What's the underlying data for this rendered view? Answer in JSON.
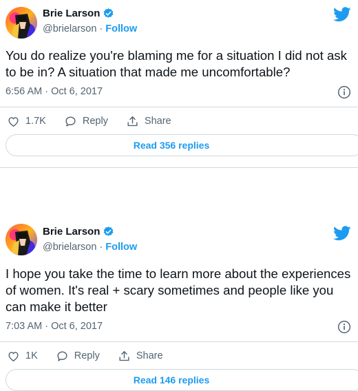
{
  "tweets": [
    {
      "author_name": "Brie Larson",
      "handle": "@brielarson",
      "separator": " · ",
      "follow_label": "Follow",
      "text": "You do realize you're blaming me for a situation I did not ask to be in? A situation that made me uncomfortable?",
      "timestamp": "6:56 AM · Oct 6, 2017",
      "like_count": "1.7K",
      "reply_label": "Reply",
      "share_label": "Share",
      "read_replies_label": "Read 356 replies"
    },
    {
      "author_name": "Brie Larson",
      "handle": "@brielarson",
      "separator": " · ",
      "follow_label": "Follow",
      "text": "I hope you take the time to learn more about the experiences of women. It's real + scary sometimes and people like you can make it better",
      "timestamp": "7:03 AM · Oct 6, 2017",
      "like_count": "1K",
      "reply_label": "Reply",
      "share_label": "Share",
      "read_replies_label": "Read 146 replies"
    }
  ],
  "icons": {
    "verified": "verified-badge-icon",
    "twitter": "twitter-bird-icon",
    "info": "info-icon",
    "like": "heart-icon",
    "reply": "speech-bubble-icon",
    "share": "share-upload-icon"
  },
  "colors": {
    "accent": "#1d9bf0",
    "text": "#0f1419",
    "secondary": "#536471",
    "border": "#cfd9de"
  }
}
